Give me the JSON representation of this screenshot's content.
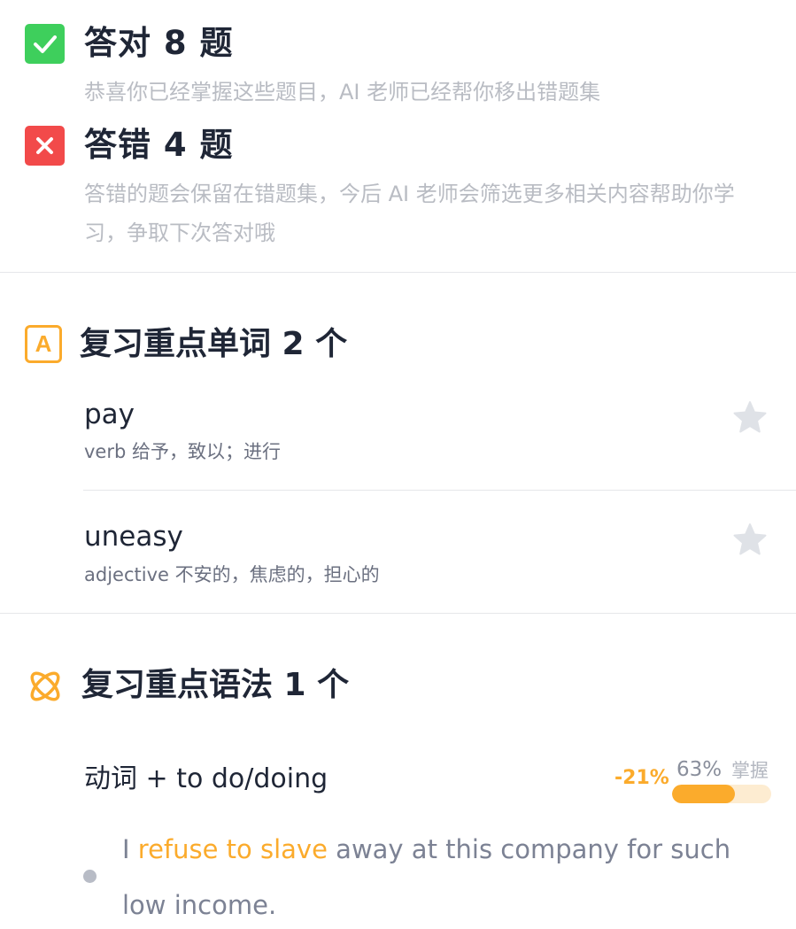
{
  "correct": {
    "title": "答对 8 题",
    "description": "恭喜你已经掌握这些题目，AI 老师已经帮你移出错题集",
    "icon": "check-icon",
    "color": "#3ecf5c"
  },
  "wrong": {
    "title": "答错 4 题",
    "description": "答错的题会保留在错题集，今后 AI 老师会筛选更多相关内容帮助你学习，争取下次答对哦",
    "icon": "close-icon",
    "color": "#f24a4a"
  },
  "words_section": {
    "title": "复习重点单词 2 个",
    "icon_letter": "A",
    "accent": "#fbab2c",
    "words": [
      {
        "word": "pay",
        "definition": "verb 给予，致以；进行"
      },
      {
        "word": "uneasy",
        "definition": "adjective 不安的，焦虑的，担心的"
      }
    ]
  },
  "grammar_section": {
    "title": "复习重点语法 1 个",
    "items": [
      {
        "name": "动词 + to do/doing",
        "delta": "-21%",
        "mastery_percent": "63%",
        "mastery_value": 0.63,
        "mastery_label": "掌握",
        "example": {
          "before": "I ",
          "highlight": "refuse to slave",
          "after": " away at this company for such low income."
        }
      }
    ]
  }
}
